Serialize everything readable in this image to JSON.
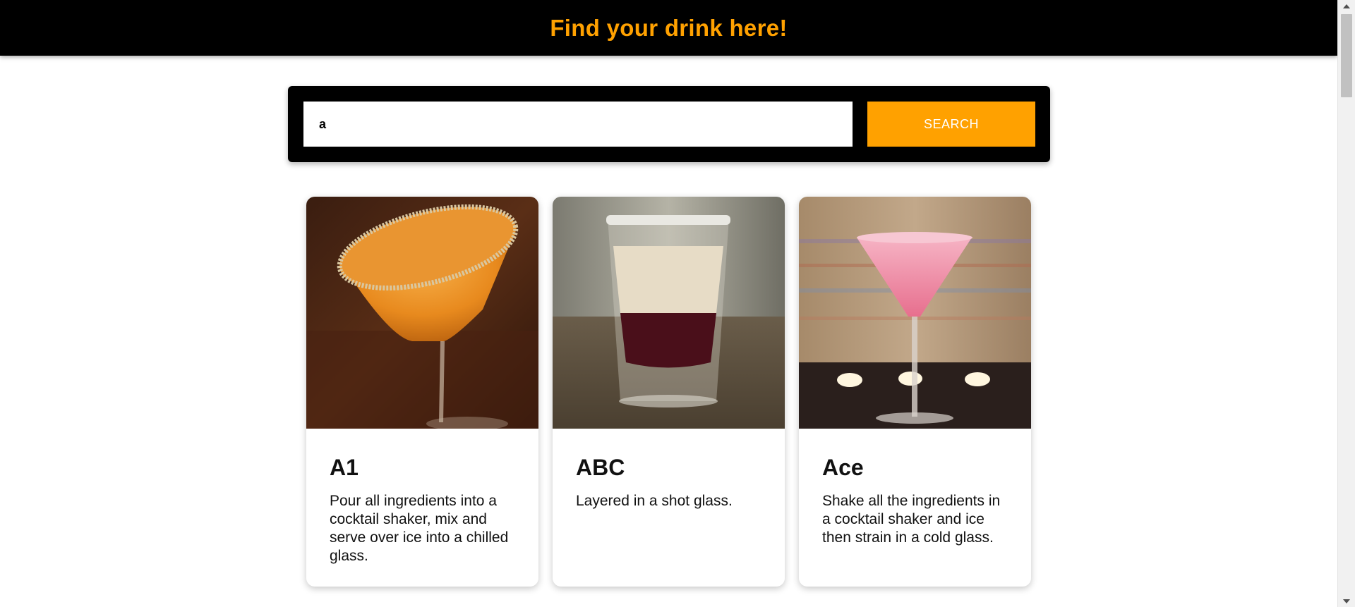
{
  "header": {
    "title": "Find your drink here!"
  },
  "search": {
    "value": "a",
    "button_label": "SEARCH"
  },
  "drinks": [
    {
      "name": "A1",
      "instructions": "Pour all ingredients into a cocktail shaker, mix and serve over ice into a chilled glass."
    },
    {
      "name": "ABC",
      "instructions": "Layered in a shot glass."
    },
    {
      "name": "Ace",
      "instructions": "Shake all the ingredients in a cocktail shaker and ice then strain in a cold glass."
    }
  ],
  "colors": {
    "accent": "#ffa100",
    "header_background": "#000000",
    "page_background": "#ffffff"
  },
  "icons": {
    "scroll_up": "scroll-up-arrow-icon",
    "scroll_down": "scroll-down-arrow-icon"
  }
}
